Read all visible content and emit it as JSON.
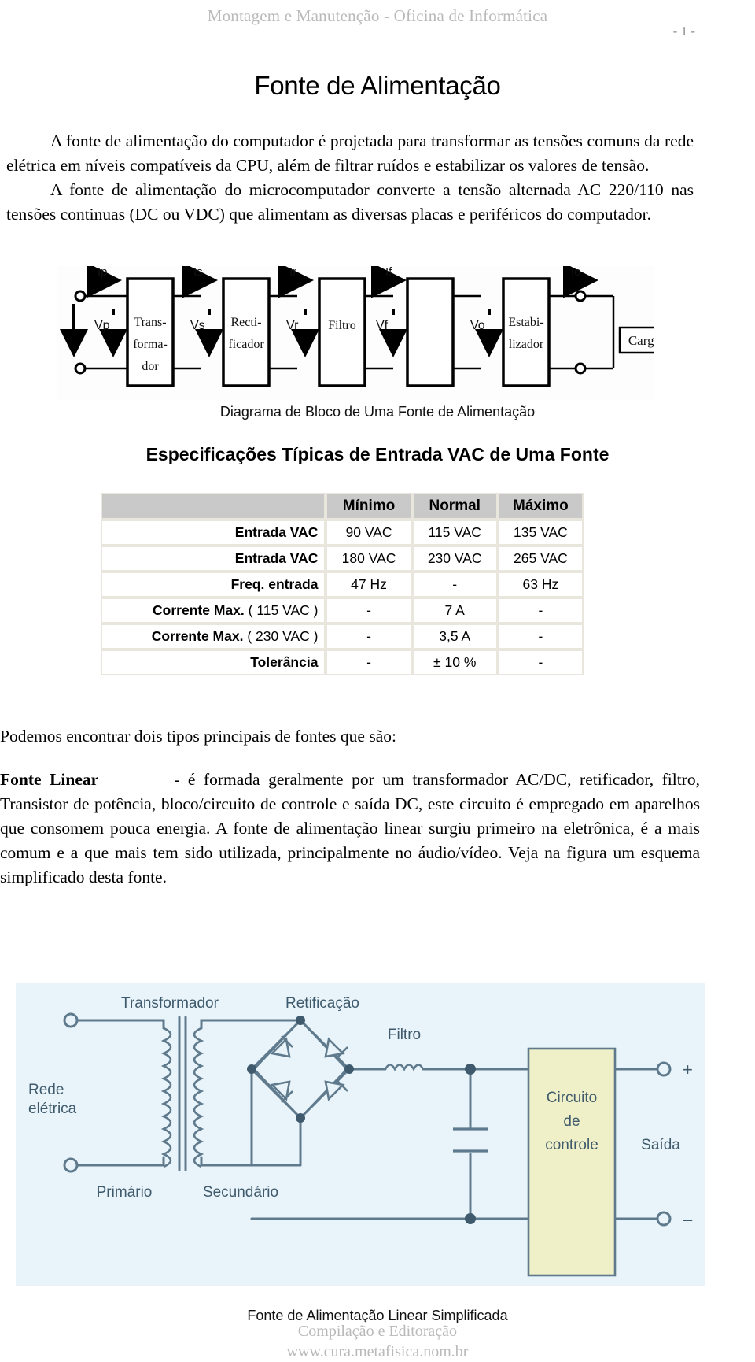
{
  "header": {
    "running_head": "Montagem e Manutenção - Oficina de Informática",
    "page_number": "- 1 -"
  },
  "title": "Fonte de Alimentação",
  "paragraphs": {
    "p1": "A fonte de alimentação do computador é projetada para transformar as tensões comuns da rede elétrica em níveis compatíveis da CPU, além de filtrar ruídos e estabilizar os valores de tensão.",
    "p2": "A fonte de alimentação do microcomputador converte a tensão alternada AC 220/110 nas tensões continuas (DC ou VDC) que alimentam as diversas placas e periféricos do computador.",
    "p3": "Podemos encontrar dois tipos principais de fontes que são:",
    "p4_bold": "Fonte Linear",
    "p4_rest": "- é formada geralmente por um transformador AC/DC, retificador, filtro, Transistor de potência, bloco/circuito de controle e saída DC, este circuito é empregado em aparelhos que consomem pouca energia. A fonte de alimentação linear surgiu primeiro na eletrônica, é a mais comum e a que mais tem sido utilizada, principalmente no áudio/vídeo. Veja na figura um esquema simplificado desta fonte."
  },
  "block_diagram": {
    "caption": "Diagrama de Bloco de Uma Fonte de Alimentação",
    "currents": [
      "Ip",
      "Is",
      "Ir",
      "If",
      "Io"
    ],
    "voltages": [
      "Vp",
      "Vs",
      "Vr",
      "Vf",
      "Vo"
    ],
    "blocks": [
      {
        "lines": [
          "Trans-",
          "forma-",
          "dor"
        ]
      },
      {
        "lines": [
          "Recti-",
          "ficador"
        ]
      },
      {
        "lines": [
          "Filtro"
        ]
      },
      {
        "lines": [
          "Estabi-",
          "lizador"
        ]
      }
    ],
    "load_label": "Carga"
  },
  "section_heading": "Especificações Típicas de Entrada VAC de Uma Fonte",
  "spec_table": {
    "columns": [
      "",
      "Mínimo",
      "Normal",
      "Máximo"
    ],
    "rows": [
      {
        "label": "Entrada VAC",
        "sub": "",
        "values": [
          "90 VAC",
          "115 VAC",
          "135 VAC"
        ]
      },
      {
        "label": "Entrada VAC",
        "sub": "",
        "values": [
          "180 VAC",
          "230 VAC",
          "265 VAC"
        ]
      },
      {
        "label": "Freq. entrada",
        "sub": "",
        "values": [
          "47 Hz",
          "-",
          "63 Hz"
        ]
      },
      {
        "label": "Corrente Max.",
        "sub": "( 115 VAC )",
        "values": [
          "-",
          "7 A",
          "-"
        ]
      },
      {
        "label": "Corrente Max.",
        "sub": "( 230 VAC )",
        "values": [
          "-",
          "3,5 A",
          "-"
        ]
      },
      {
        "label": "Tolerância",
        "sub": "",
        "values": [
          "-",
          "± 10 %",
          "-"
        ]
      }
    ]
  },
  "schematic": {
    "caption": "Fonte de Alimentação Linear Simplificada",
    "labels": {
      "transformador": "Transformador",
      "retificacao": "Retificação",
      "filtro": "Filtro",
      "rede_l1": "Rede",
      "rede_l2": "elétrica",
      "primario": "Primário",
      "secundario": "Secundário",
      "circuito_l1": "Circuito",
      "circuito_l2": "de",
      "circuito_l3": "controle",
      "saida": "Saída",
      "plus": "+",
      "minus": "–"
    },
    "colors": {
      "background": "#e8f4fa",
      "line": "#5f7a8c",
      "control_box_fill": "#f0f0c8",
      "text": "#3f5a6c"
    }
  },
  "footer": {
    "line1": "Compilação e Editoração",
    "line2": "www.cura.metafisica.nom.br"
  }
}
